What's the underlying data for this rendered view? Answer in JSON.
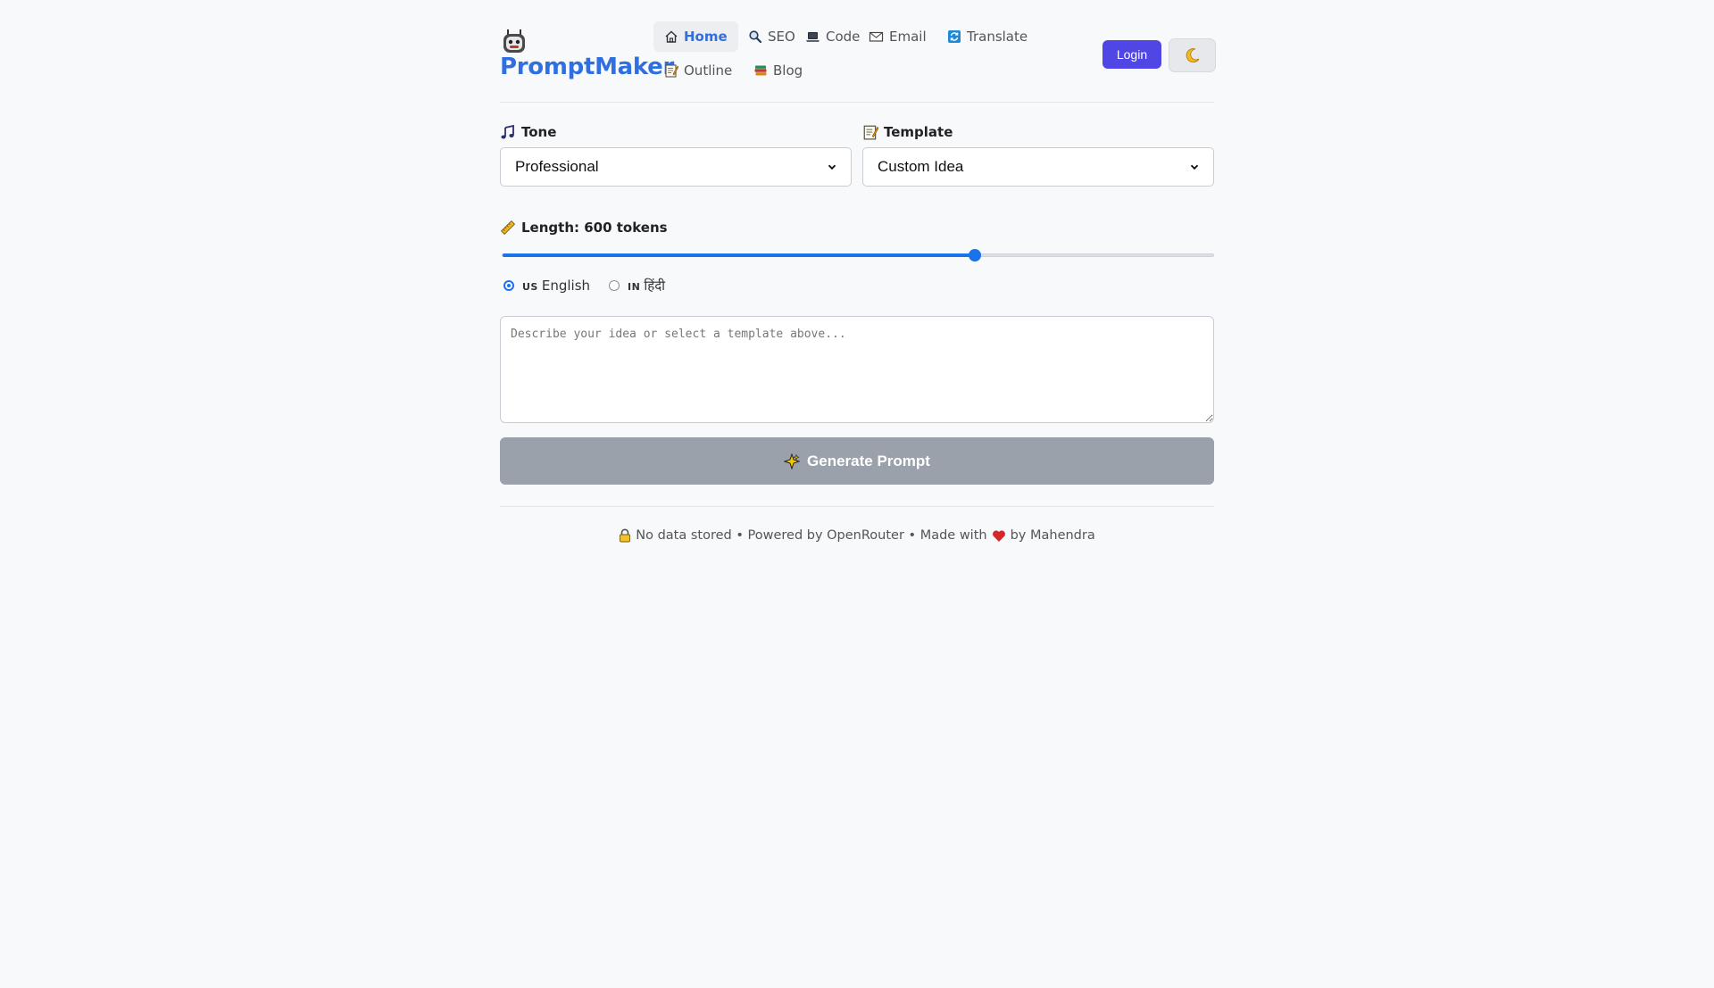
{
  "brand": {
    "name": "PromptMaker",
    "logo_icon": "robot-icon"
  },
  "nav": {
    "items": [
      {
        "label": "Home",
        "icon": "home-icon",
        "active": true
      },
      {
        "label": "SEO",
        "icon": "magnifier-icon"
      },
      {
        "label": "Code",
        "icon": "laptop-icon"
      },
      {
        "label": "Email",
        "icon": "envelope-icon"
      },
      {
        "label": "Translate",
        "icon": "translate-icon"
      },
      {
        "label": "Outline",
        "icon": "memo-icon"
      },
      {
        "label": "Blog",
        "icon": "books-icon"
      }
    ]
  },
  "header": {
    "login_label": "Login",
    "theme_icon": "moon-icon"
  },
  "form": {
    "tone": {
      "label": "Tone",
      "icon": "music-note-icon",
      "selected": "Professional"
    },
    "template": {
      "label": "Template",
      "icon": "memo-icon",
      "selected": "Custom Idea"
    },
    "length": {
      "label": "Length: 600 tokens",
      "icon": "ruler-icon",
      "fraction": 0.664
    },
    "languages": [
      {
        "flag": "US",
        "label": "English",
        "checked": true
      },
      {
        "flag": "IN",
        "label": "हिंदी",
        "checked": false
      }
    ],
    "prompt_placeholder": "Describe your idea or select a template above...",
    "generate_label": "Generate Prompt",
    "generate_icon": "sparkles-icon"
  },
  "footer": {
    "part1": "No data stored • Powered by OpenRouter • Made with",
    "part2": "by Mahendra",
    "lock_icon": "lock-icon",
    "heart_icon": "heart-icon"
  },
  "colors": {
    "accent": "#2f6fe0",
    "login": "#4f46e5",
    "slider": "#1a73e8",
    "button_disabled": "#9ba1ab"
  }
}
